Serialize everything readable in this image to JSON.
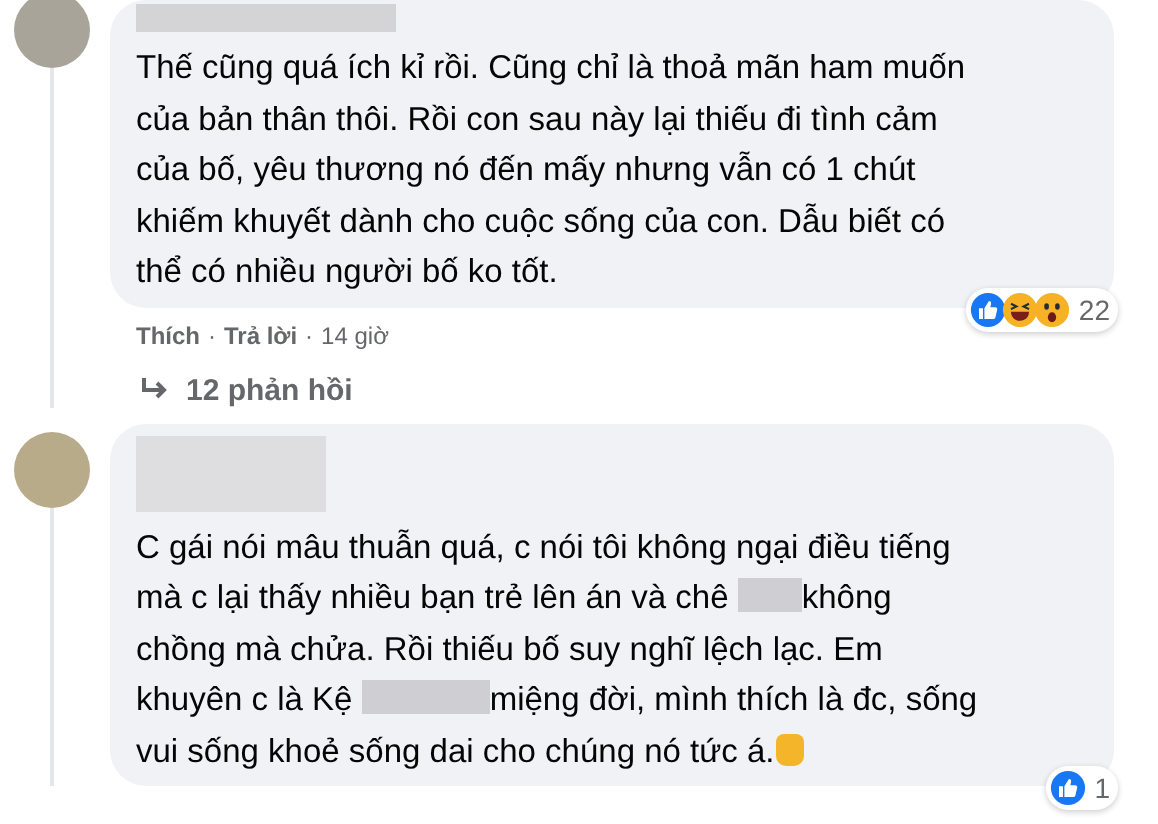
{
  "comments": [
    {
      "author_redacted": true,
      "lines": [
        [
          {
            "kind": "text",
            "text": "Thế cũng quá ích kỉ rồi. Cũng chỉ là thoả mãn ham muốn"
          }
        ],
        [
          {
            "kind": "text",
            "text": "của bản thân thôi. Rồi con sau này lại thiếu đi tình cảm"
          }
        ],
        [
          {
            "kind": "text",
            "text": "của bố, yêu thương nó đến mấy nhưng vẫn có 1 chút"
          }
        ],
        [
          {
            "kind": "text",
            "text": "khiếm khuyết dành cho cuộc sống của con. Dẫu biết có"
          }
        ],
        [
          {
            "kind": "text",
            "text": "thể có nhiều người bố ko tốt."
          }
        ]
      ],
      "reactions": [
        {
          "kind": "like"
        },
        {
          "kind": "haha"
        },
        {
          "kind": "wow"
        }
      ],
      "reaction_count": "22",
      "actions": [
        "Thích",
        "Trả lời"
      ],
      "separator": "·",
      "time": "14 giờ",
      "replies": "12 phản hồi"
    },
    {
      "author_redacted": true,
      "lines": [
        [
          {
            "kind": "text",
            "text": "C gái nói mâu thuẫn quá, c nói tôi không ngại điều tiếng"
          }
        ],
        [
          {
            "kind": "text",
            "text": "mà c lại thấy nhiều bạn trẻ lên án và chê "
          },
          {
            "kind": "redacted"
          },
          {
            "kind": "text",
            "text": "không"
          }
        ],
        [
          {
            "kind": "text",
            "text": "chồng mà chửa. Rồi thiếu bố suy nghĩ lệch lạc. Em"
          }
        ],
        [
          {
            "kind": "text",
            "text": "khuyên c là Kệ "
          },
          {
            "kind": "redacted",
            "long": true
          },
          {
            "kind": "text",
            "text": "miệng đời, mình thích là đc, sống"
          }
        ],
        [
          {
            "kind": "text",
            "text": "vui sống khoẻ sống dai cho chúng nó tức á."
          },
          {
            "kind": "emoji"
          }
        ]
      ],
      "reactions": [
        {
          "kind": "like"
        }
      ],
      "reaction_count": "1"
    }
  ]
}
